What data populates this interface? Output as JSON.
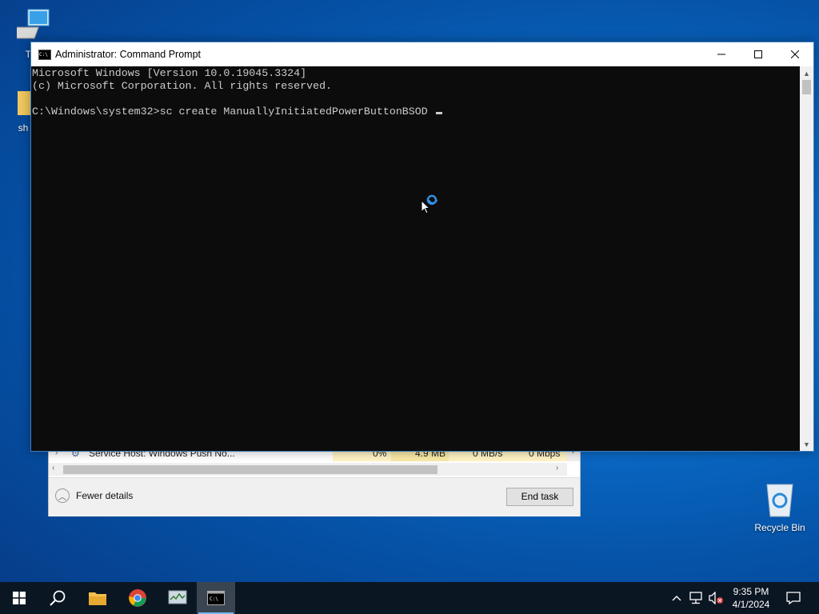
{
  "desktop": {
    "icons": [
      {
        "label": "This"
      },
      {
        "label": "sh"
      },
      {
        "label": "Recycle Bin"
      }
    ]
  },
  "task_manager": {
    "row": {
      "name": "Service Host: Windows Push No...",
      "cpu": "0%",
      "memory": "4.9 MB",
      "disk": "0 MB/s",
      "network": "0 Mbps"
    },
    "fewer_details": "Fewer details",
    "end_task": "End task"
  },
  "cmd": {
    "title": "Administrator: Command Prompt",
    "lines": [
      "Microsoft Windows [Version 10.0.19045.3324]",
      "(c) Microsoft Corporation. All rights reserved.",
      "",
      "C:\\Windows\\system32>sc create ManuallyInitiatedPowerButtonBSOD "
    ]
  },
  "taskbar": {
    "clock_time": "9:35 PM",
    "clock_date": "4/1/2024"
  },
  "colors": {
    "desktop": "#0a6cc8",
    "terminal_bg": "#0c0c0c",
    "terminal_fg": "#cccccc",
    "taskbar": "#0b1623",
    "accent": "#76b9ed"
  }
}
